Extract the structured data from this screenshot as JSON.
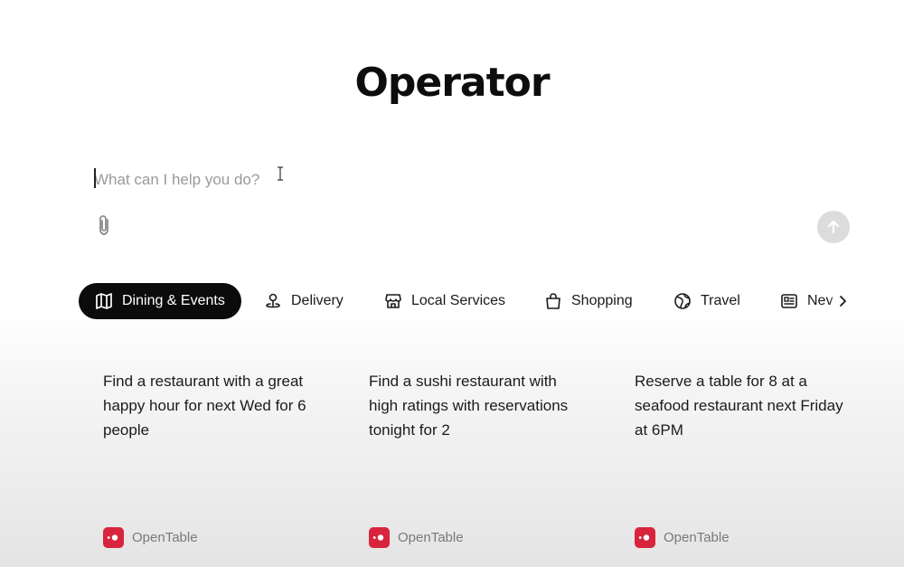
{
  "app": {
    "title": "Operator"
  },
  "prompt": {
    "placeholder": "What can I help you do?",
    "value": ""
  },
  "tabs": [
    {
      "label": "Dining & Events",
      "icon": "map-icon",
      "active": true
    },
    {
      "label": "Delivery",
      "icon": "location-pin-icon",
      "active": false
    },
    {
      "label": "Local Services",
      "icon": "storefront-icon",
      "active": false
    },
    {
      "label": "Shopping",
      "icon": "shopping-bag-icon",
      "active": false
    },
    {
      "label": "Travel",
      "icon": "globe-icon",
      "active": false
    },
    {
      "label": "Nev",
      "icon": "newspaper-icon",
      "active": false
    }
  ],
  "cards": [
    {
      "text": "Find a restaurant with a great happy hour for next Wed for 6 people",
      "brand": "OpenTable"
    },
    {
      "text": "Find a sushi restaurant with high ratings with reservations tonight for 2",
      "brand": "OpenTable"
    },
    {
      "text": "Reserve a table for 8 at a seafood restaurant next Friday at 6PM",
      "brand": "OpenTable"
    }
  ],
  "colors": {
    "active_tab_bg": "#0b0b0b",
    "brand_red": "#d8243c",
    "send_button_bg": "#dcdcdc"
  }
}
